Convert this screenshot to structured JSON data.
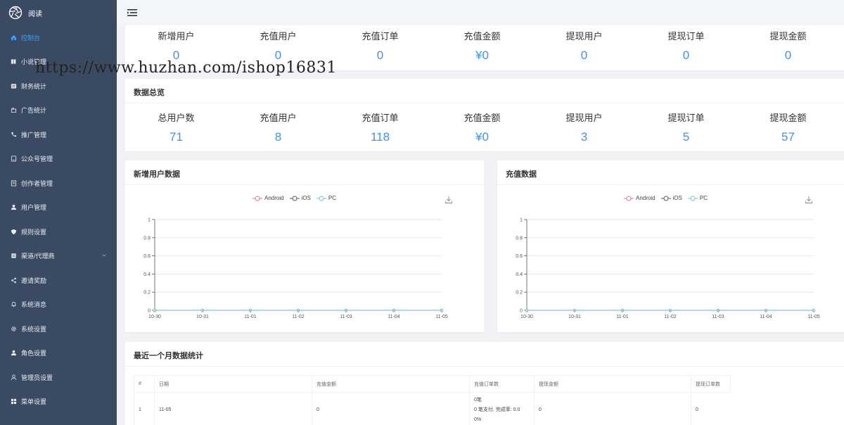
{
  "sidebar": {
    "brand_name": "阅读",
    "items": [
      {
        "label": "控制台",
        "icon": "home-icon",
        "active": true
      },
      {
        "label": "小说管理",
        "icon": "book-icon"
      },
      {
        "label": "财务统计",
        "icon": "finance-icon"
      },
      {
        "label": "广告统计",
        "icon": "ad-icon"
      },
      {
        "label": "推广管理",
        "icon": "phone-icon"
      },
      {
        "label": "公众号管理",
        "icon": "account-icon"
      },
      {
        "label": "创作者管理",
        "icon": "creator-icon"
      },
      {
        "label": "用户管理",
        "icon": "user-icon"
      },
      {
        "label": "规则设置",
        "icon": "rule-icon"
      },
      {
        "label": "渠道/代理商",
        "icon": "channel-icon",
        "has_submenu": true
      },
      {
        "label": "邀请奖励",
        "icon": "share-icon"
      },
      {
        "label": "系统消息",
        "icon": "bell-icon"
      },
      {
        "label": "系统设置",
        "icon": "gear-icon"
      },
      {
        "label": "角色设置",
        "icon": "role-icon"
      },
      {
        "label": "管理员设置",
        "icon": "admin-icon"
      },
      {
        "label": "菜单设置",
        "icon": "grid-icon"
      }
    ]
  },
  "watermark": "https://www.huzhan.com/ishop16831",
  "today_stats": [
    {
      "label": "新增用户",
      "value": "0"
    },
    {
      "label": "充值用户",
      "value": "0"
    },
    {
      "label": "充值订单",
      "value": "0"
    },
    {
      "label": "充值金额",
      "value": "¥0"
    },
    {
      "label": "提现用户",
      "value": "0"
    },
    {
      "label": "提现订单",
      "value": "0"
    },
    {
      "label": "提现金额",
      "value": "0"
    }
  ],
  "overview": {
    "title": "数据总览",
    "stats": [
      {
        "label": "总用户数",
        "value": "71"
      },
      {
        "label": "充值用户",
        "value": "8"
      },
      {
        "label": "充值订单",
        "value": "118"
      },
      {
        "label": "充值金额",
        "value": "¥0"
      },
      {
        "label": "提现用户",
        "value": "3"
      },
      {
        "label": "提现订单",
        "value": "5"
      },
      {
        "label": "提现金额",
        "value": "57"
      }
    ]
  },
  "chart_data": [
    {
      "type": "line",
      "title": "新增用户数据",
      "x": [
        "10-30",
        "10-31",
        "11-01",
        "11-02",
        "11-03",
        "11-04",
        "11-05"
      ],
      "ylim": [
        0,
        1
      ],
      "yticks": [
        "0",
        "0.2",
        "0.4",
        "0.6",
        "0.8",
        "1"
      ],
      "grid": true,
      "legend_position": "top",
      "series": [
        {
          "name": "Android",
          "color": "#e07a7a",
          "values": [
            0,
            0,
            0,
            0,
            0,
            0,
            0
          ]
        },
        {
          "name": "iOS",
          "color": "#555555",
          "values": [
            0,
            0,
            0,
            0,
            0,
            0,
            0
          ]
        },
        {
          "name": "PC",
          "color": "#7ec4cf",
          "values": [
            0,
            0,
            0,
            0,
            0,
            0,
            0
          ]
        }
      ]
    },
    {
      "type": "line",
      "title": "充值数据",
      "x": [
        "10-30",
        "10-31",
        "11-01",
        "11-02",
        "11-03",
        "11-04",
        "11-05"
      ],
      "ylim": [
        0,
        1
      ],
      "yticks": [
        "0",
        "0.2",
        "0.4",
        "0.6",
        "0.8",
        "1"
      ],
      "grid": true,
      "legend_position": "top",
      "series": [
        {
          "name": "Android",
          "color": "#e07a7a",
          "values": [
            0,
            0,
            0,
            0,
            0,
            0,
            0
          ]
        },
        {
          "name": "iOS",
          "color": "#555555",
          "values": [
            0,
            0,
            0,
            0,
            0,
            0,
            0
          ]
        },
        {
          "name": "PC",
          "color": "#7ec4cf",
          "values": [
            0,
            0,
            0,
            0,
            0,
            0,
            0
          ]
        }
      ]
    }
  ],
  "monthly": {
    "title": "最近一个月数据统计",
    "columns": [
      "#",
      "日期",
      "充值金额",
      "充值订单数",
      "提现金额",
      "提现订单数"
    ],
    "rows": [
      {
        "index": "1",
        "date": "11-05",
        "recharge_amount": "0",
        "order_lines": [
          "0笔",
          "0 笔支付, 完成率: 0.0",
          "0%"
        ],
        "withdraw_amount": "0",
        "withdraw_orders": "0"
      }
    ]
  },
  "colors": {
    "sidebar": "#3a4a63",
    "accent": "#3c94e8",
    "active_nav": "#3ea1ff"
  }
}
